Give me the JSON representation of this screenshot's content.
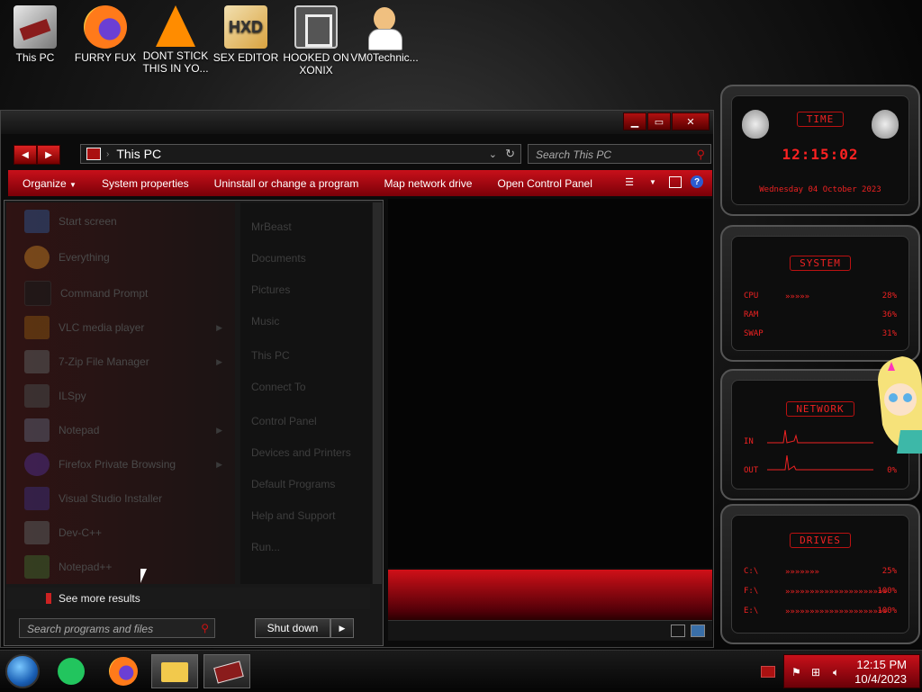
{
  "desktop": {
    "icons": [
      {
        "label": "This PC",
        "icon": "computer-icon",
        "color": "#8a1c1c"
      },
      {
        "label": "FURRY FUX",
        "icon": "firefox-icon",
        "color": "#ff7a1a"
      },
      {
        "label": "DONT STICK THIS IN YO...",
        "icon": "vlc-cone-icon",
        "color": "#ff8c00"
      },
      {
        "label": "SEX EDITOR",
        "icon": "hxd-icon",
        "color": "#d9a340"
      },
      {
        "label": "HOOKED ON XONIX",
        "icon": "xonix-icon",
        "color": "#6a6a6a"
      },
      {
        "label": "VM0Technic...",
        "icon": "doctor-avatar-icon",
        "color": "#f0c080"
      }
    ]
  },
  "explorer": {
    "address": "This PC",
    "search_placeholder": "Search This PC",
    "toolbar": {
      "organize": "Organize",
      "system_properties": "System properties",
      "uninstall": "Uninstall or change a program",
      "map_drive": "Map network drive",
      "control_panel": "Open Control Panel",
      "help": "?"
    }
  },
  "start_menu": {
    "programs": [
      {
        "label": "Start screen"
      },
      {
        "label": "Everything"
      },
      {
        "label": "Command Prompt"
      },
      {
        "label": "VLC media player",
        "submenu": true
      },
      {
        "label": "7-Zip File Manager",
        "submenu": true
      },
      {
        "label": "ILSpy"
      },
      {
        "label": "Notepad",
        "submenu": true
      },
      {
        "label": "Firefox Private Browsing",
        "submenu": true
      },
      {
        "label": "Visual Studio Installer"
      },
      {
        "label": "Dev-C++"
      },
      {
        "label": "Notepad++"
      }
    ],
    "right_items": [
      "MrBeast",
      "Documents",
      "Pictures",
      "Music",
      "This PC",
      "Connect To",
      "Control Panel",
      "Devices and Printers",
      "Default Programs",
      "Help and Support",
      "Run..."
    ],
    "see_more": "See more results",
    "search_placeholder": "Search programs and files",
    "shutdown": "Shut down"
  },
  "gadgets": {
    "time": {
      "title": "TIME",
      "clock": "12:15:02",
      "date": "Wednesday 04 October 2023"
    },
    "system": {
      "title": "SYSTEM",
      "rows": [
        {
          "label": "CPU",
          "value": "28%",
          "bar": "»»»»»"
        },
        {
          "label": "RAM",
          "value": "36%"
        },
        {
          "label": "SWAP",
          "value": "31%"
        }
      ]
    },
    "network": {
      "title": "NETWORK",
      "in_label": "IN",
      "in_value": "",
      "out_label": "OUT",
      "out_value": "0%"
    },
    "drives": {
      "title": "DRIVES",
      "rows": [
        {
          "label": "C:\\",
          "value": "25%",
          "bar": "»»»»»»»"
        },
        {
          "label": "F:\\",
          "value": "100%",
          "bar": "»»»»»»»»»»»»»»»»»»»»»"
        },
        {
          "label": "E:\\",
          "value": "100%",
          "bar": "»»»»»»»»»»»»»»»»»»»»»"
        }
      ]
    }
  },
  "taskbar": {
    "time": "12:15 PM",
    "date": "10/4/2023",
    "accent": "#c8101a"
  }
}
